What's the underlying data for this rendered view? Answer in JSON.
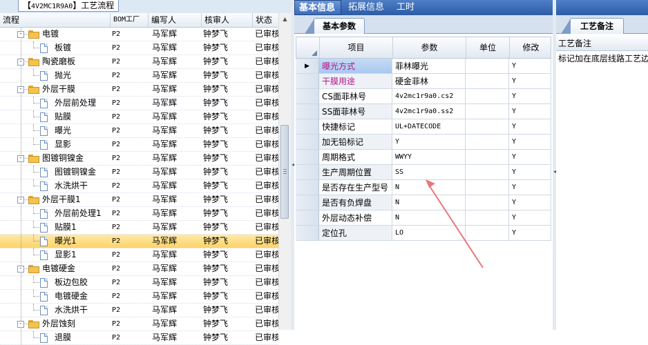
{
  "left_panel": {
    "title_prefix": "【",
    "title_code": "4V2MC1R9A0",
    "title_suffix": "】工艺流程",
    "columns": {
      "flow": "流程",
      "bom": "BOM工厂",
      "author": "编写人",
      "reviewer": "核审人",
      "status": "状态"
    },
    "rows": [
      {
        "level": 1,
        "label": "电镀",
        "bom": "P2",
        "author": "马军辉",
        "reviewer": "钟梦飞",
        "status": "已审核"
      },
      {
        "level": 2,
        "label": "板镀",
        "bom": "P2",
        "author": "马军辉",
        "reviewer": "钟梦飞",
        "status": "已审核"
      },
      {
        "level": 1,
        "label": "陶瓷磨板",
        "bom": "P2",
        "author": "马军辉",
        "reviewer": "钟梦飞",
        "status": "已审核"
      },
      {
        "level": 2,
        "label": "抛光",
        "bom": "P2",
        "author": "马军辉",
        "reviewer": "钟梦飞",
        "status": "已审核"
      },
      {
        "level": 1,
        "label": "外层干膜",
        "bom": "P2",
        "author": "马军辉",
        "reviewer": "钟梦飞",
        "status": "已审核"
      },
      {
        "level": 2,
        "label": "外层前处理",
        "bom": "P2",
        "author": "马军辉",
        "reviewer": "钟梦飞",
        "status": "已审核"
      },
      {
        "level": 2,
        "label": "贴膜",
        "bom": "P2",
        "author": "马军辉",
        "reviewer": "钟梦飞",
        "status": "已审核"
      },
      {
        "level": 2,
        "label": "曝光",
        "bom": "P2",
        "author": "马军辉",
        "reviewer": "钟梦飞",
        "status": "已审核"
      },
      {
        "level": 2,
        "label": "显影",
        "bom": "P2",
        "author": "马军辉",
        "reviewer": "钟梦飞",
        "status": "已审核"
      },
      {
        "level": 1,
        "label": "图镀铜镍金",
        "bom": "P2",
        "author": "马军辉",
        "reviewer": "钟梦飞",
        "status": "已审核"
      },
      {
        "level": 2,
        "label": "图镀铜镍金",
        "bom": "P2",
        "author": "马军辉",
        "reviewer": "钟梦飞",
        "status": "已审核"
      },
      {
        "level": 2,
        "label": "水洗烘干",
        "bom": "P2",
        "author": "马军辉",
        "reviewer": "钟梦飞",
        "status": "已审核"
      },
      {
        "level": 1,
        "label": "外层干膜1",
        "bom": "P2",
        "author": "马军辉",
        "reviewer": "钟梦飞",
        "status": "已审核"
      },
      {
        "level": 2,
        "label": "外层前处理1",
        "bom": "P2",
        "author": "马军辉",
        "reviewer": "钟梦飞",
        "status": "已审核"
      },
      {
        "level": 2,
        "label": "贴膜1",
        "bom": "P2",
        "author": "马军辉",
        "reviewer": "钟梦飞",
        "status": "已审核"
      },
      {
        "level": 2,
        "label": "曝光1",
        "bom": "P2",
        "author": "马军辉",
        "reviewer": "钟梦飞",
        "status": "已审核",
        "selected": true
      },
      {
        "level": 2,
        "label": "显影1",
        "bom": "P2",
        "author": "马军辉",
        "reviewer": "钟梦飞",
        "status": "已审核"
      },
      {
        "level": 1,
        "label": "电镀硬金",
        "bom": "P2",
        "author": "马军辉",
        "reviewer": "钟梦飞",
        "status": "已审核"
      },
      {
        "level": 2,
        "label": "板边包胶",
        "bom": "P2",
        "author": "马军辉",
        "reviewer": "钟梦飞",
        "status": "已审核"
      },
      {
        "level": 2,
        "label": "电镀硬金",
        "bom": "P2",
        "author": "马军辉",
        "reviewer": "钟梦飞",
        "status": "已审核"
      },
      {
        "level": 2,
        "label": "水洗烘干",
        "bom": "P2",
        "author": "马军辉",
        "reviewer": "钟梦飞",
        "status": "已审核"
      },
      {
        "level": 1,
        "label": "外层蚀刻",
        "bom": "P2",
        "author": "马军辉",
        "reviewer": "钟梦飞",
        "status": "已审核"
      },
      {
        "level": 2,
        "label": "退膜",
        "bom": "P2",
        "author": "马军辉",
        "reviewer": "钟梦飞",
        "status": "已审核"
      }
    ]
  },
  "top_tabs": [
    "基本信息",
    "拓展信息",
    "工时"
  ],
  "middle_panel": {
    "sub_tab": "基本参数",
    "grid_columns": {
      "item": "项目",
      "param": "参数",
      "unit": "单位",
      "modify": "修改"
    },
    "current_row_marker": "▶",
    "rows": [
      {
        "item": "曝光方式",
        "param": "菲林曝光",
        "unit": "",
        "modify": "Y",
        "item_color": "#b0178a",
        "current": true
      },
      {
        "item": "干膜用途",
        "param": "硬金菲林",
        "unit": "",
        "modify": "Y",
        "item_color": "#b0178a"
      },
      {
        "item": "CS面菲林号",
        "param": "4v2mc1r9a0.cs2",
        "unit": "",
        "modify": "Y",
        "mono": true
      },
      {
        "item": "SS面菲林号",
        "param": "4v2mc1r9a0.ss2",
        "unit": "",
        "modify": "Y",
        "mono": true
      },
      {
        "item": "快捷标记",
        "param": "UL+DATECODE",
        "unit": "",
        "modify": "Y",
        "mono": true
      },
      {
        "item": "加无铅标记",
        "param": "Y",
        "unit": "",
        "modify": "Y",
        "mono": true
      },
      {
        "item": "周期格式",
        "param": "WWYY",
        "unit": "",
        "modify": "Y",
        "mono": true
      },
      {
        "item": "生产周期位置",
        "param": "SS",
        "unit": "",
        "modify": "Y",
        "mono": true
      },
      {
        "item": "是否存在生产型号",
        "param": "N",
        "unit": "",
        "modify": "Y",
        "mono": true
      },
      {
        "item": "是否有负焊盘",
        "param": "N",
        "unit": "",
        "modify": "Y",
        "mono": true
      },
      {
        "item": "外层动态补偿",
        "param": "N",
        "unit": "",
        "modify": "Y",
        "mono": true
      },
      {
        "item": "定位孔",
        "param": "LO",
        "unit": "",
        "modify": "Y",
        "mono": true
      }
    ]
  },
  "right_panel": {
    "tab": "工艺备注",
    "header": "工艺备注",
    "remark": "标记加在底层线路工艺边"
  },
  "colors": {
    "accent_tab": "#2d5ca6",
    "selected_row": "#fcd36a",
    "highlight_item": "#b0178a",
    "annotation_arrow": "#e8777a"
  }
}
